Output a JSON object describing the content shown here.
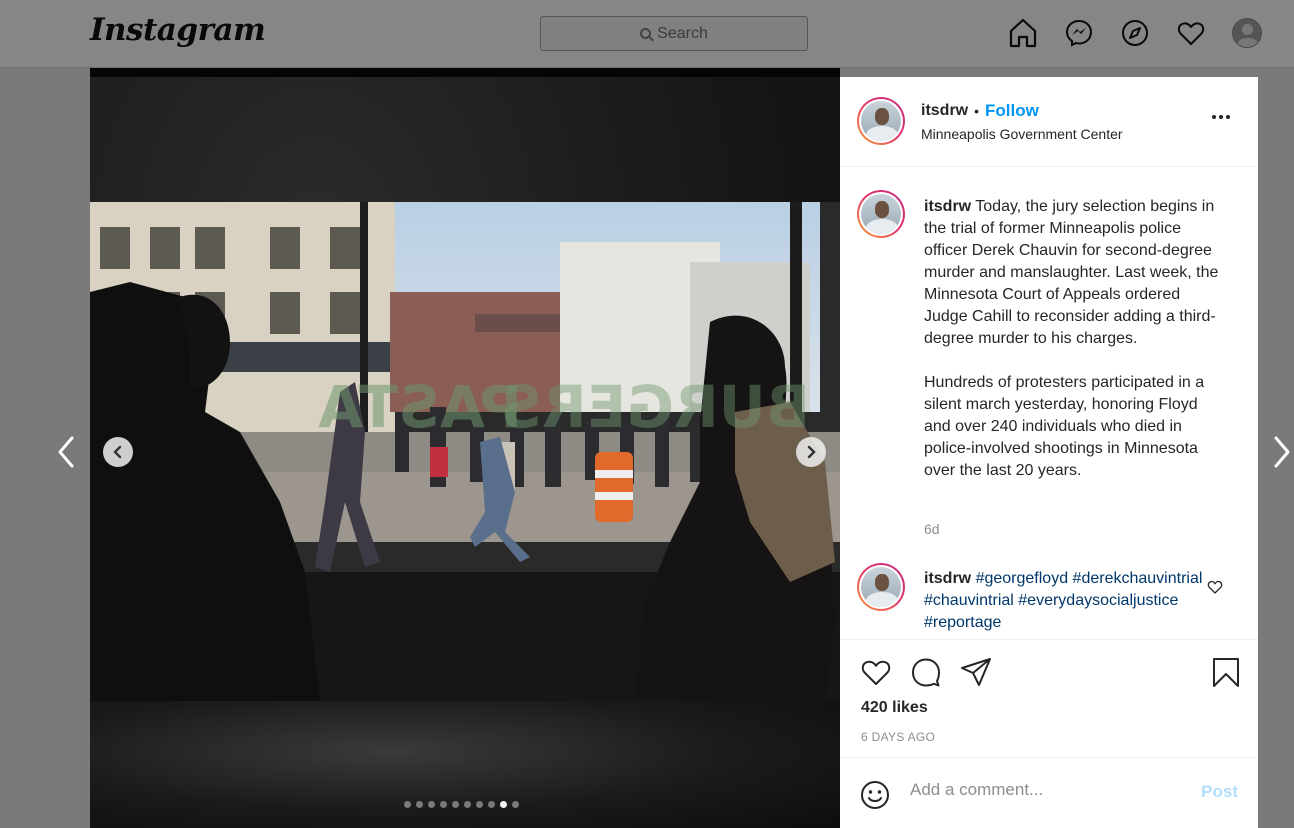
{
  "nav": {
    "logo": "Instagram",
    "search_placeholder": "Search",
    "icons": [
      "home-icon",
      "messenger-icon",
      "explore-icon",
      "activity-heart-icon",
      "profile-avatar"
    ]
  },
  "media": {
    "carousel_total": 10,
    "carousel_active_index": 8,
    "icons": [
      "carousel-prev-icon",
      "carousel-next-icon"
    ]
  },
  "post_header": {
    "username": "itsdrw",
    "separator": "•",
    "follow_label": "Follow",
    "location": "Minneapolis Government Center",
    "more_icon": "more-options-icon"
  },
  "caption": {
    "username": "itsdrw",
    "paragraph1": "Today, the jury selection begins in the trial of former Minneapolis police officer Derek Chauvin for second-degree murder and manslaughter. Last week, the Minnesota Court of Appeals ordered Judge Cahill to reconsider adding a third-degree murder to his charges.",
    "paragraph2": "Hundreds of protesters participated in a silent march yesterday, honoring Floyd and over 240 individuals who died in police-involved shootings in Minnesota over the last 20 years.",
    "time_ago": "6d"
  },
  "comment": {
    "username": "itsdrw",
    "tags": [
      "#georgefloyd",
      "#derekchauvintrial",
      "#chauvintrial",
      "#everydaysocialjustice",
      "#reportage"
    ]
  },
  "actions": {
    "icons": [
      "like-heart-icon",
      "comment-icon",
      "share-icon",
      "bookmark-icon"
    ],
    "likes": "420 likes",
    "date": "6 DAYS AGO"
  },
  "add_comment": {
    "placeholder": "Add a comment...",
    "post_label": "Post",
    "emoji_icon": "emoji-icon"
  },
  "colors": {
    "accent_blue": "#0095f6",
    "hashtag_blue": "#00376b",
    "post_disabled": "#b2dffc",
    "muted": "#8e8e8e"
  }
}
